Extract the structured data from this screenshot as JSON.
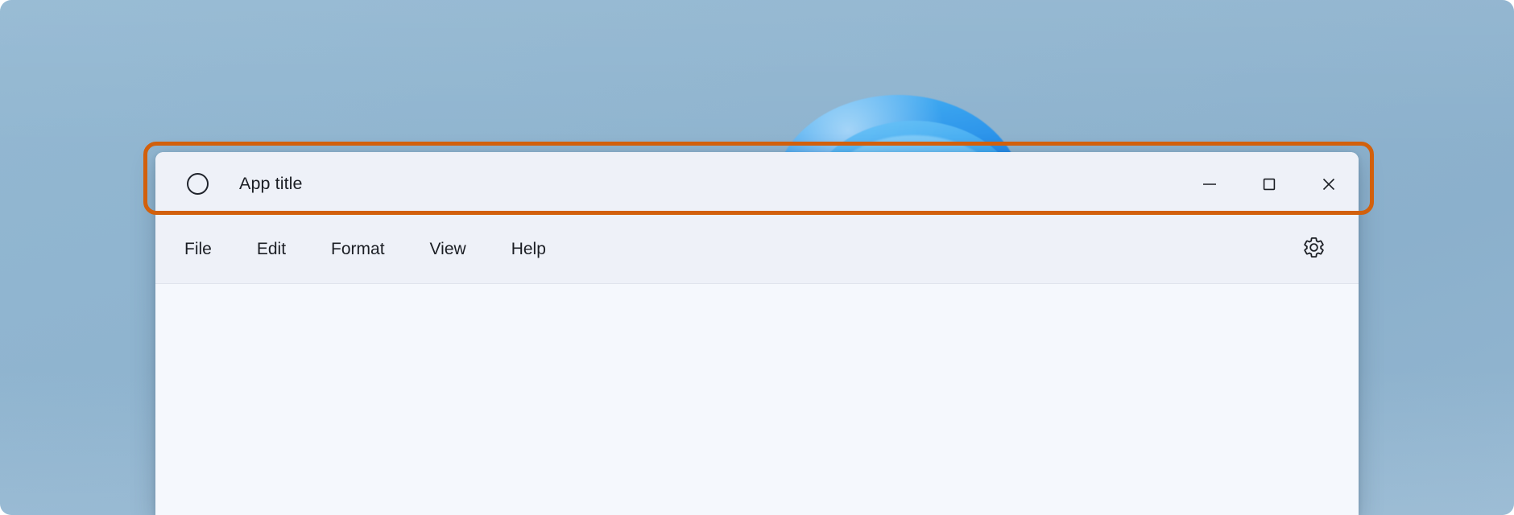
{
  "window": {
    "title": "App title",
    "app_icon": "circle-icon",
    "controls": [
      {
        "name": "minimize",
        "label": "Minimize",
        "glyph": "minimize-icon"
      },
      {
        "name": "maximize",
        "label": "Maximize",
        "glyph": "maximize-icon"
      },
      {
        "name": "close",
        "label": "Close",
        "glyph": "close-icon"
      }
    ]
  },
  "menu": {
    "items": [
      {
        "label": "File"
      },
      {
        "label": "Edit"
      },
      {
        "label": "Format"
      },
      {
        "label": "View"
      },
      {
        "label": "Help"
      }
    ],
    "settings": {
      "label": "Settings",
      "icon": "gear-icon"
    }
  },
  "content": {
    "text": ""
  },
  "annotation": {
    "type": "highlight-rectangle",
    "target": "title-bar",
    "color": "#d2600c"
  },
  "colors": {
    "desktop_background": "#8fb4cf",
    "wallpaper_bloom": "#2a92ea",
    "title_bar_background": "#eef1f8",
    "menu_bar_background": "#eef1f8",
    "content_background": "#f5f8fd",
    "text": "#1b1e24",
    "annotation_orange": "#d2600c",
    "divider": "#dfe3ec"
  }
}
